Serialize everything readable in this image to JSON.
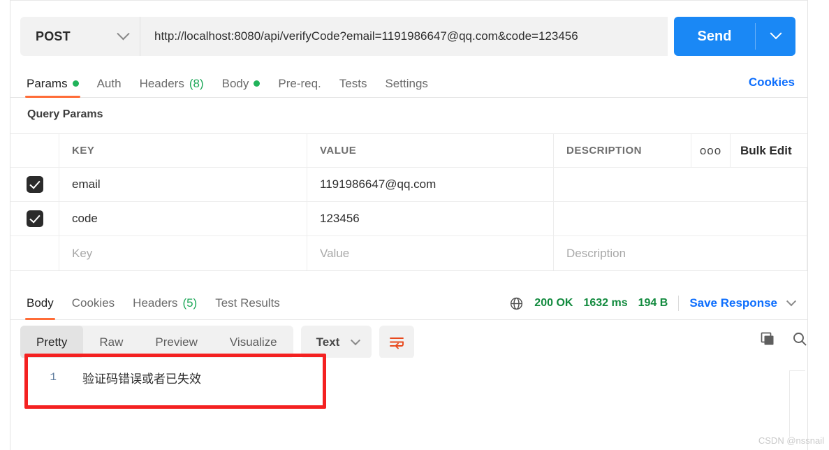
{
  "request": {
    "method": "POST",
    "url": "http://localhost:8080/api/verifyCode?email=1191986647@qq.com&code=123456",
    "send_label": "Send",
    "tabs": [
      {
        "label": "Params",
        "marker": "dot",
        "active": true
      },
      {
        "label": "Auth",
        "marker": "",
        "active": false
      },
      {
        "label": "Headers",
        "count": "(8)",
        "active": false
      },
      {
        "label": "Body",
        "marker": "dot",
        "active": false
      },
      {
        "label": "Pre-req.",
        "marker": "",
        "active": false
      },
      {
        "label": "Tests",
        "marker": "",
        "active": false
      },
      {
        "label": "Settings",
        "marker": "",
        "active": false
      }
    ],
    "cookies_link": "Cookies"
  },
  "query_params": {
    "title": "Query Params",
    "headers": {
      "key": "KEY",
      "value": "VALUE",
      "description": "DESCRIPTION",
      "dots": "ooo",
      "bulk_edit": "Bulk Edit"
    },
    "rows": [
      {
        "checked": true,
        "key": "email",
        "value": "1191986647@qq.com",
        "description": ""
      },
      {
        "checked": true,
        "key": "code",
        "value": "123456",
        "description": ""
      }
    ],
    "placeholder_row": {
      "key": "Key",
      "value": "Value",
      "description": "Description"
    }
  },
  "response": {
    "tabs": [
      {
        "label": "Body",
        "active": true
      },
      {
        "label": "Cookies",
        "active": false
      },
      {
        "label": "Headers",
        "count": "(5)",
        "active": false
      },
      {
        "label": "Test Results",
        "active": false
      }
    ],
    "status": {
      "code": "200 OK",
      "time": "1632 ms",
      "size": "194 B"
    },
    "save_response": "Save Response",
    "view_modes": [
      {
        "label": "Pretty",
        "active": true
      },
      {
        "label": "Raw",
        "active": false
      },
      {
        "label": "Preview",
        "active": false
      },
      {
        "label": "Visualize",
        "active": false
      }
    ],
    "format": "Text",
    "body_lines": [
      {
        "number": "1",
        "text": "验证码错误或者已失效"
      }
    ]
  },
  "watermark": "CSDN @nssnail",
  "colors": {
    "accent_orange": "#ff6c37",
    "send_blue": "#1a88f5",
    "link_blue": "#0d6efd",
    "status_green": "#128a3e",
    "dot_green": "#21b35a",
    "annotation_red": "#f42121"
  }
}
